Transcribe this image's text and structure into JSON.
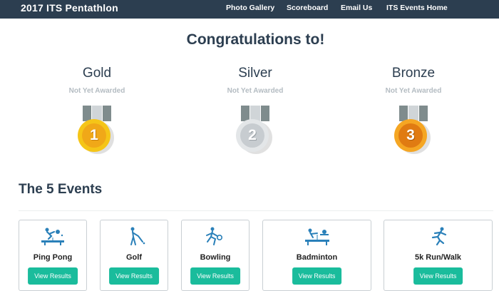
{
  "navbar": {
    "brand": "2017 ITS Pentathlon",
    "links": [
      "Photo Gallery",
      "Scoreboard",
      "Email Us",
      "ITS Events Home"
    ]
  },
  "heading": "Congratulations to!",
  "medals": [
    {
      "title": "Gold",
      "status": "Not Yet Awarded",
      "number": "1"
    },
    {
      "title": "Silver",
      "status": "Not Yet Awarded",
      "number": "2"
    },
    {
      "title": "Bronze",
      "status": "Not Yet Awarded",
      "number": "3"
    }
  ],
  "events_section": {
    "title": "The 5 Events",
    "events": [
      {
        "name": "Ping Pong",
        "icon": "ping-pong-icon",
        "button": "View Results"
      },
      {
        "name": "Golf",
        "icon": "golf-icon",
        "button": "View Results"
      },
      {
        "name": "Bowling",
        "icon": "bowling-icon",
        "button": "View Results"
      },
      {
        "name": "Badminton",
        "icon": "badminton-icon",
        "button": "View Results"
      },
      {
        "name": "5k Run/Walk",
        "icon": "running-icon",
        "button": "View Results"
      }
    ]
  },
  "colors": {
    "navbar": "#2c3e50",
    "accent": "#1abc9c",
    "muted": "#b4bcc2",
    "gold": "#f5c518",
    "silver": "#c7ccd0",
    "bronze": "#e07b12",
    "icon_blue": "#2a80b9"
  }
}
